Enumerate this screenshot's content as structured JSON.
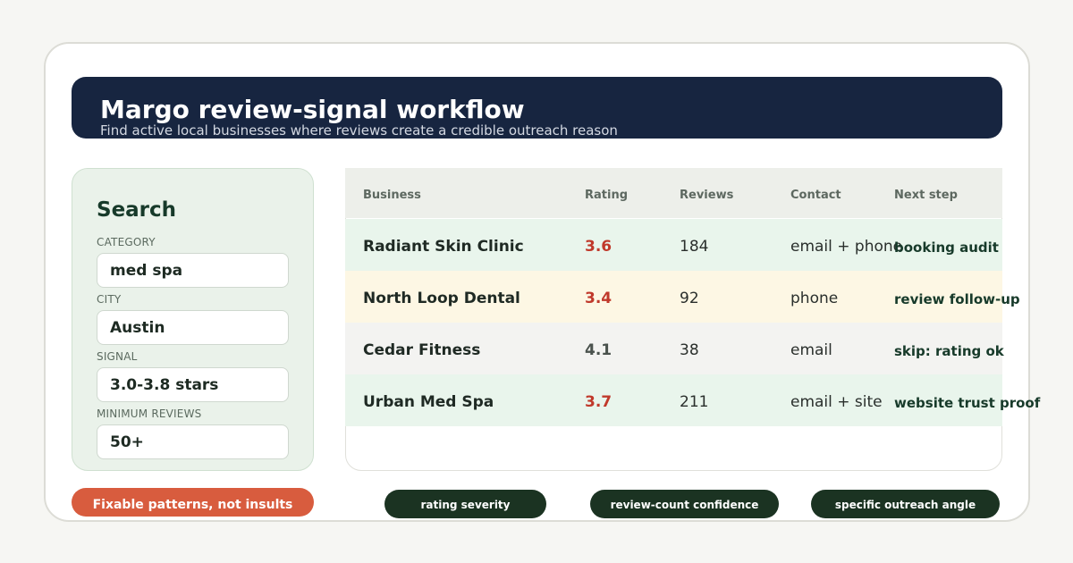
{
  "header": {
    "title": "Margo review-signal workflow",
    "subtitle": "Find active local businesses where reviews create a credible outreach reason"
  },
  "search": {
    "title": "Search",
    "fields": [
      {
        "label": "CATEGORY",
        "value": "med spa"
      },
      {
        "label": "CITY",
        "value": "Austin"
      },
      {
        "label": "SIGNAL",
        "value": "3.0-3.8 stars"
      },
      {
        "label": "MINIMUM REVIEWS",
        "value": "50+"
      }
    ]
  },
  "table": {
    "columns": [
      "Business",
      "Rating",
      "Reviews",
      "Contact",
      "Next step"
    ],
    "rows": [
      {
        "business": "Radiant Skin Clinic",
        "rating": "3.6",
        "reviews": "184",
        "contact": "email + phone",
        "next": "booking audit"
      },
      {
        "business": "North Loop Dental",
        "rating": "3.4",
        "reviews": "92",
        "contact": "phone",
        "next": "review follow-up"
      },
      {
        "business": "Cedar Fitness",
        "rating": "4.1",
        "reviews": "38",
        "contact": "email",
        "next": "skip: rating ok"
      },
      {
        "business": "Urban Med Spa",
        "rating": "3.7",
        "reviews": "211",
        "contact": "email + site",
        "next": "website trust proof"
      }
    ]
  },
  "footer": {
    "warning_label": "Fixable patterns, not insults",
    "tags": [
      "rating severity",
      "review-count confidence",
      "specific outreach angle"
    ]
  },
  "colors": {
    "banner": "#172540",
    "rating_flag": "#c0392b",
    "rating_ok": "#4a524d",
    "row_green": "#e9f5ec",
    "row_yellow": "#fdf7e4",
    "row_grey": "#f3f3f1",
    "warning": "#d85c3e",
    "tag": "#1b3322"
  }
}
